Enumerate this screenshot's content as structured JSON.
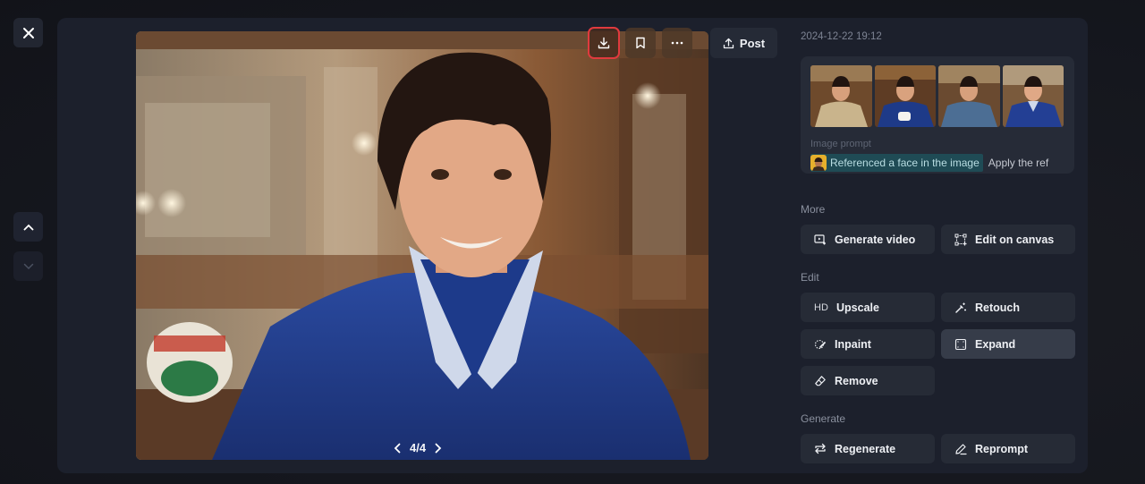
{
  "nav": {
    "close_icon": "close-icon",
    "prev_icon": "chevron-up-icon",
    "next_icon": "chevron-down-icon"
  },
  "image_toolbar": {
    "download_icon": "download-icon",
    "bookmark_icon": "bookmark-icon",
    "more_icon": "more-horizontal-icon",
    "post_label": "Post",
    "post_icon": "upload-icon"
  },
  "pager": {
    "current": 4,
    "total": 4,
    "text": "4/4"
  },
  "details": {
    "timestamp": "2024-12-22 19:12",
    "thumbnails_count": 4,
    "prompt_label": "Image prompt",
    "reference_chip": "Referenced a face in the image",
    "prompt_text": "Apply the ref"
  },
  "sections": {
    "more": {
      "label": "More",
      "buttons": [
        {
          "label": "Generate video",
          "icon": "video-plus-icon"
        },
        {
          "label": "Edit on canvas",
          "icon": "canvas-icon"
        }
      ]
    },
    "edit": {
      "label": "Edit",
      "buttons": [
        {
          "label": "Upscale",
          "icon": "hd-icon",
          "icon_text": "HD"
        },
        {
          "label": "Retouch",
          "icon": "magic-wand-icon"
        },
        {
          "label": "Inpaint",
          "icon": "inpaint-icon"
        },
        {
          "label": "Expand",
          "icon": "expand-icon"
        },
        {
          "label": "Remove",
          "icon": "eraser-icon"
        }
      ]
    },
    "generate": {
      "label": "Generate",
      "buttons": [
        {
          "label": "Regenerate",
          "icon": "regenerate-icon"
        },
        {
          "label": "Reprompt",
          "icon": "pencil-icon"
        }
      ]
    }
  }
}
